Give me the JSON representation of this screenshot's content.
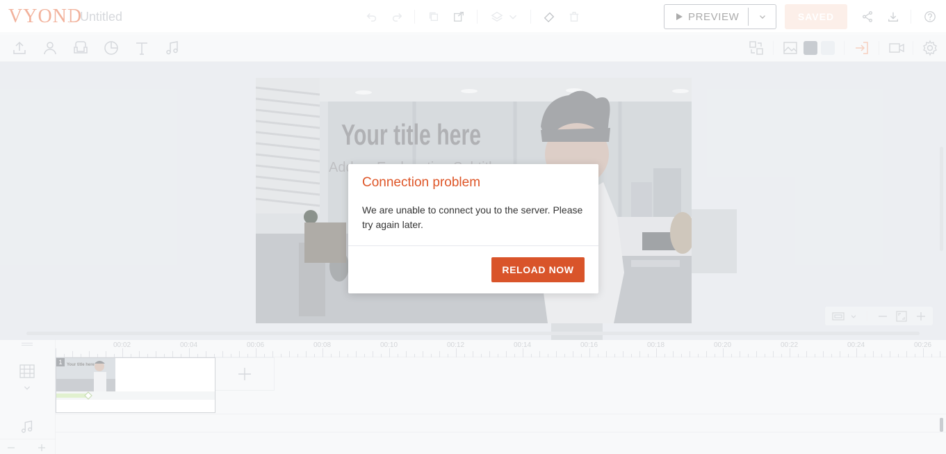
{
  "app": {
    "logo": "VYOND",
    "document_title": "Untitled"
  },
  "topbar": {
    "preview_label": "PREVIEW",
    "saved_label": "SAVED",
    "icons": [
      "undo-icon",
      "redo-icon",
      "copy-icon",
      "paste-icon",
      "layers-icon",
      "chevron-down-icon",
      "brush-icon",
      "trash-icon",
      "share-icon",
      "download-icon",
      "help-icon"
    ]
  },
  "toolbar2": {
    "left_icons": [
      "upload-icon",
      "character-icon",
      "props-icon",
      "chart-icon",
      "text-icon",
      "music-icon"
    ],
    "right_icons": [
      "swap-icon",
      "image-icon",
      "enter-icon",
      "camera-icon",
      "settings-icon"
    ],
    "swatch_colors": [
      "#9ca2ab",
      "#e1e5ec"
    ]
  },
  "canvas": {
    "title": "Your title here",
    "subtitle": "Add an Explanation Subtitle"
  },
  "dialog": {
    "title": "Connection problem",
    "message": "We are unable to connect you to the server. Please try again later.",
    "button": "RELOAD NOW"
  },
  "timeline": {
    "ruler_labels": [
      "00:02",
      "00:04",
      "00:06",
      "00:08",
      "00:10",
      "00:12",
      "00:14",
      "00:16",
      "00:18",
      "00:20",
      "00:22",
      "00:24",
      "00:26"
    ],
    "scene_number": "1",
    "thumb_title": "Your title here",
    "scene_progress": 0.2
  },
  "colors": {
    "accent": "#de5527",
    "logo": "#e8744c",
    "saved_bg": "#f9e2d7"
  }
}
